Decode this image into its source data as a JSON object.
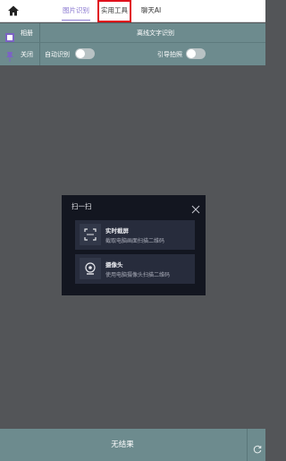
{
  "header": {
    "home_icon": "home-icon",
    "tabs": [
      {
        "label": "图片识别",
        "active": true
      },
      {
        "label": "实用工具",
        "highlighted": true
      },
      {
        "label": "聊天AI"
      }
    ]
  },
  "toolbar": {
    "album_label": "相册",
    "offline_ocr_label": "离线文字识别",
    "close_label": "关闭",
    "auto_recognize_label": "自动识别",
    "auto_recognize_on": false,
    "guide_photo_label": "引导拍照",
    "guide_photo_on": false
  },
  "scan_dialog": {
    "title": "扫一扫",
    "options": [
      {
        "icon": "screen-capture-icon",
        "title": "实时截屏",
        "subtitle": "截取电脑画面扫描二维码"
      },
      {
        "icon": "camera-icon",
        "title": "摄像头",
        "subtitle": "使用电脑摄像头扫描二维码"
      }
    ]
  },
  "result": {
    "text": "无结果"
  },
  "colors": {
    "toolbar_bg": "#6d8b8e",
    "tab_active": "#8a78d0",
    "highlight_border": "#e0101c",
    "modal_bg": "#131620",
    "option_bg": "#272c3c"
  }
}
